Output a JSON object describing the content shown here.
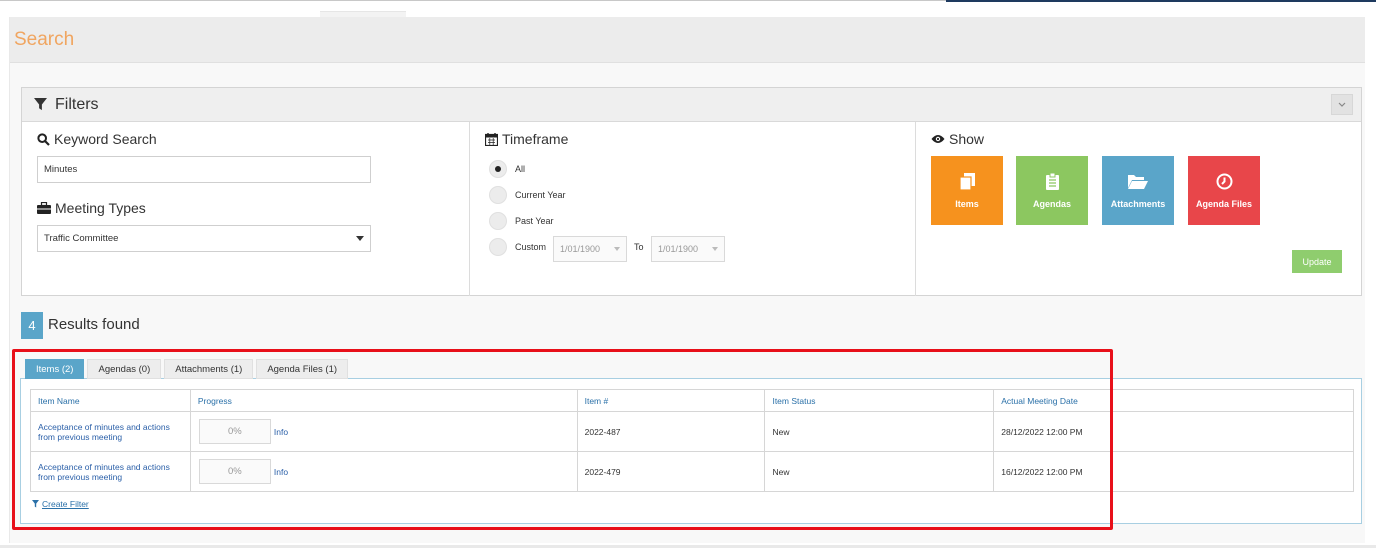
{
  "page": {
    "title": "Search"
  },
  "filters": {
    "title": "Filters",
    "collapse_icon": "chevron-down",
    "keyword": {
      "label": "Keyword Search",
      "value": "Minutes"
    },
    "meeting_types": {
      "label": "Meeting Types",
      "selected": "Traffic Committee"
    },
    "timeframe": {
      "label": "Timeframe",
      "options": [
        {
          "label": "All",
          "selected": true
        },
        {
          "label": "Current Year",
          "selected": false
        },
        {
          "label": "Past Year",
          "selected": false
        },
        {
          "label": "Custom",
          "selected": false
        }
      ],
      "from_date": "1/01/1900",
      "to_label": "To",
      "to_date": "1/01/1900"
    },
    "show": {
      "label": "Show",
      "buttons": [
        {
          "label": "Items",
          "color": "#f6921e",
          "icon": "copy-icon"
        },
        {
          "label": "Agendas",
          "color": "#8cc760",
          "icon": "clipboard-icon"
        },
        {
          "label": "Attachments",
          "color": "#5aa5c9",
          "icon": "folder-open-icon"
        },
        {
          "label": "Agenda Files",
          "color": "#e8464a",
          "icon": "clock-icon"
        }
      ],
      "update_label": "Update"
    }
  },
  "results": {
    "count": "4",
    "label": "Results found",
    "tabs": [
      {
        "label": "Items (2)",
        "active": true
      },
      {
        "label": "Agendas (0)",
        "active": false
      },
      {
        "label": "Attachments (1)",
        "active": false
      },
      {
        "label": "Agenda Files (1)",
        "active": false
      }
    ],
    "columns": [
      "Item Name",
      "Progress",
      "Item #",
      "Item Status",
      "Actual Meeting Date"
    ],
    "rows": [
      {
        "name": "Acceptance of minutes and actions from previous meeting",
        "progress": "0%",
        "progress_value": 0,
        "info": "Info",
        "item_no": "2022-487",
        "status": "New",
        "date": "28/12/2022 12:00 PM"
      },
      {
        "name": "Acceptance of minutes and actions from previous meeting",
        "progress": "0%",
        "progress_value": 0,
        "info": "Info",
        "item_no": "2022-479",
        "status": "New",
        "date": "16/12/2022 12:00 PM"
      }
    ],
    "create_filter": "Create Filter"
  }
}
